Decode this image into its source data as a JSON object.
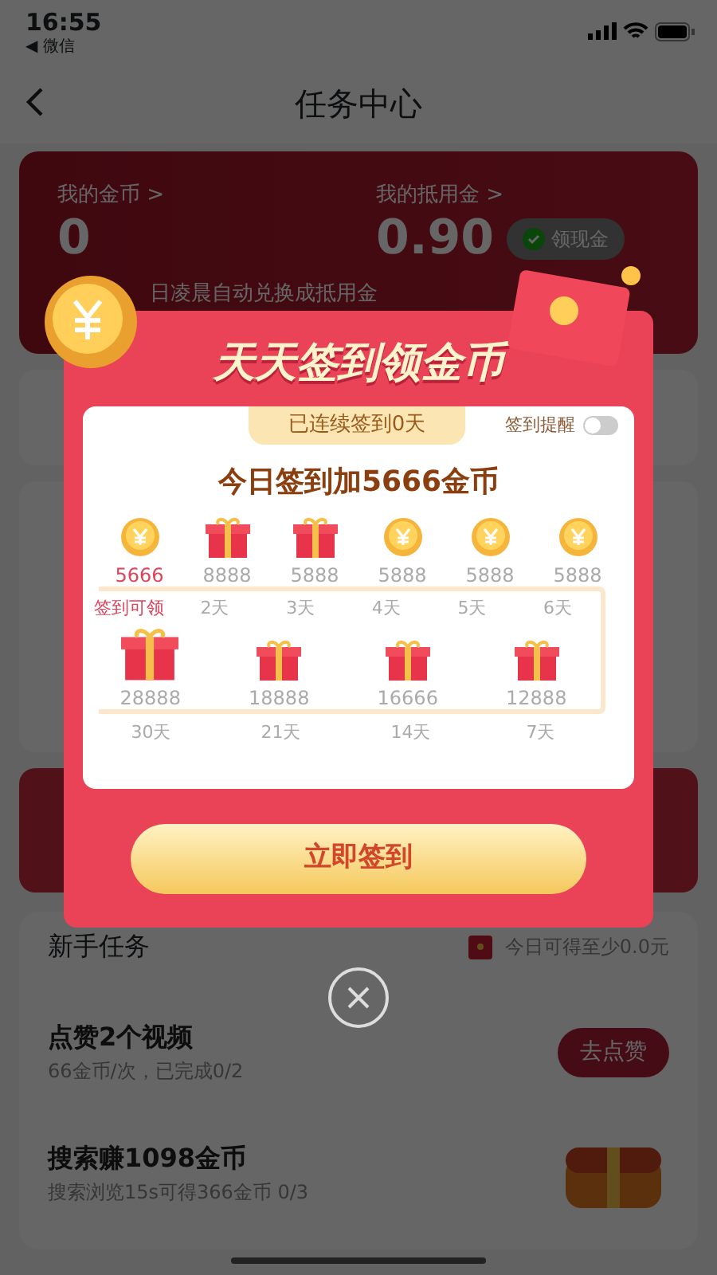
{
  "status_bar": {
    "time": "16:55",
    "back_app": "◀ 微信"
  },
  "nav": {
    "title": "任务中心"
  },
  "wallet": {
    "coins_label": "我的金币 >",
    "coins": "0",
    "voucher_label": "我的抵用金 >",
    "voucher": "0.90",
    "cash_button": "领现金",
    "note": "日凌晨自动兑换成抵用金"
  },
  "newbie_tasks": {
    "title": "新手任务",
    "summary": "今日可得至少0.0元",
    "tasks": [
      {
        "kind": "button",
        "title": "点赞2个视频",
        "detail": "66金币/次，已完成0/2",
        "action": "去点赞"
      },
      {
        "kind": "chest",
        "title": "搜索赚1098金币",
        "detail": "搜索浏览15s可得366金币 0/3"
      }
    ]
  },
  "signin_dialog": {
    "title": "天天签到领金币",
    "streak": "已连续签到0天",
    "reminder_label": "签到提醒",
    "reminder_on": false,
    "headline": "今日签到加5666金币",
    "week": [
      {
        "kind": "coin",
        "amount": "5666",
        "day": "签到可领",
        "selected": true
      },
      {
        "kind": "gift",
        "amount": "8888",
        "day": "2天",
        "selected": false
      },
      {
        "kind": "gift",
        "amount": "5888",
        "day": "3天",
        "selected": false
      },
      {
        "kind": "coin",
        "amount": "5888",
        "day": "4天",
        "selected": false
      },
      {
        "kind": "coin",
        "amount": "5888",
        "day": "5天",
        "selected": false
      },
      {
        "kind": "coin",
        "amount": "5888",
        "day": "6天",
        "selected": false
      }
    ],
    "milestones": [
      {
        "kind": "big_gift",
        "amount": "28888",
        "day": "30天"
      },
      {
        "kind": "gift",
        "amount": "18888",
        "day": "21天"
      },
      {
        "kind": "gift",
        "amount": "16666",
        "day": "14天"
      },
      {
        "kind": "gift",
        "amount": "12888",
        "day": "7天"
      }
    ],
    "button": "立即签到"
  }
}
